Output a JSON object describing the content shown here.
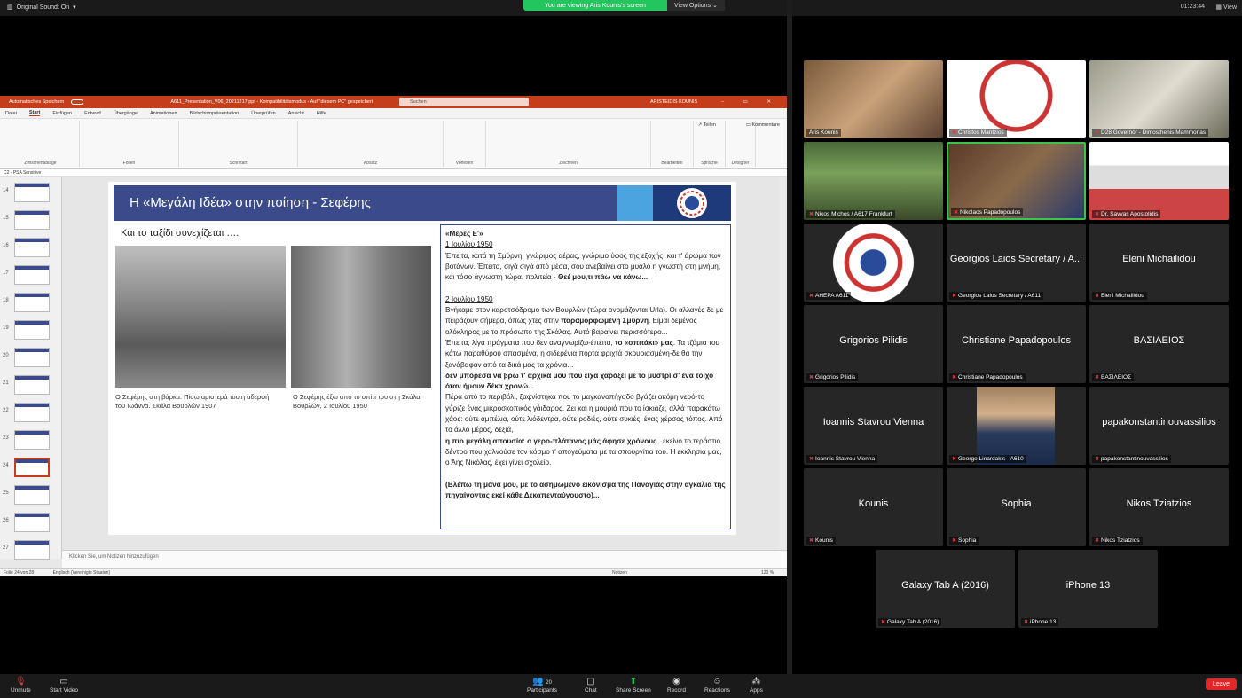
{
  "top": {
    "original_sound": "Original Sound: On",
    "viewing": "You are viewing Aris Kounis's screen",
    "view_options": "View Options",
    "clock": "01:23:44",
    "view": "View"
  },
  "ppt": {
    "autosave": "Automatisches Speichern",
    "filename": "A611_Presentation_V06_20211217.ppt - Kompatibilitätsmodus - Auf \"diesem PC\" gespeichert",
    "search": "Suchen",
    "user": "ARISTEIDIS KOUNIS",
    "tabs": [
      "Datei",
      "Start",
      "Einfügen",
      "Entwurf",
      "Übergänge",
      "Animationen",
      "Bildschirmpräsentation",
      "Überprüfen",
      "Ansicht",
      "Hilfe"
    ],
    "share": "Teilen",
    "comments": "Kommentare",
    "groups": [
      "Zwischenablage",
      "Folien",
      "Schriftart",
      "Absatz",
      "Vorlesen",
      "Zeichnen",
      "Bearbeiten",
      "Sprache",
      "Designer"
    ],
    "file_tab": "C2 - PSA Sensitive",
    "thumb_numbers": [
      "14",
      "15",
      "16",
      "17",
      "18",
      "19",
      "20",
      "21",
      "22",
      "23",
      "24",
      "25",
      "26",
      "27"
    ],
    "notes": "Klicken Sie, um Notizen hinzuzufügen",
    "status_left": "Folie 24 von 28",
    "status_lang": "Englisch (Vereinigte Staaten)",
    "status_notes": "Notizen",
    "zoom": "120 %"
  },
  "slide": {
    "title": "Η «Μεγάλη Ιδέα» στην ποίηση - Σεφέρης",
    "subtitle": "Και το ταξίδι συνεχίζεται ….",
    "caption1": "Ο Σεφέρης στη βάρκα. Πίσω αριστερά του η αδερφή του Ιωάννα. Σκάλα Βουρλών 1907",
    "caption2": "Ο Σεφέρης έξω από το σπίτι του στη Σκάλα Βουρλών, 2 Ιουλίου 1950",
    "t_head": "«Μέρες Ε'»",
    "t_date1": "1 Ιουλίου 1950",
    "t_p1": "Έπειτα, κατά τη Σμύρνη: γνώριμος αέρας, γνώριμο ύφος της εξοχής, και τ' άρωμα των βοτάνων. Έπειτα, σιγά σιγά από μέσα, σου ανεβαίνει στο μυαλό η γνωστή στη μνήμη, και τόσο άγνωστη τώρα, πολιτεία - ",
    "t_p1b": "Θεέ μου,τι πάω να κάνω...",
    "t_date2": "2 Ιουλίου 1950",
    "t_p2a": "Βγήκαμε στον καροτσόδρομο των Βουρλών (τώρα ονομάζονται Urla). Οι αλλαγές δε με πειράζουν σήμερα, όπως χτες στην ",
    "t_p2b": "παραμορφωμένη Σμύρνη",
    "t_p2c": ". Είμαι δεμένος ολόκληρος με το πρόσωπο της Σκάλας. Αυτό βαραίνει περισσότερο...",
    "t_p3a": "Έπειτα, λίγα πράγματα που δεν αναγνωρίζω-έπειτα, ",
    "t_p3b": "το «σπιτάκι» μας",
    "t_p3c": ". Τα τζάμια του κάτω παραθύρου σπασμένα, η σιδερένια πόρτα φριχτά σκουριασμένη-δε θα την ξανάβαφαν από τα δικά μας τα χρόνια...",
    "t_p4": "δεν μπόρεσα να βρω τ' αρχικά μου που είχα χαράξει με το μυστρί σ' ένα τοίχο όταν ήμουν δέκα χρονώ...",
    "t_p5": "Πέρα από το περιβόλι, ξαφνίστηκα που το μαγκανοπήγαδο βγάζει ακόμη νερό-το γύριζε ένας μικροσκοπικός γάιδαρος. Ζει και η μουριά που το ίσκιαζε, αλλά παρακάτω χάος: ούτε αμπέλια, ούτε λιόδεντρα, ούτε ροδιές, ούτε συκιές: ένας χέρσος τόπος. Από το άλλο μέρος, δεξιά,",
    "t_p6a": "η πιο μεγάλη απουσία: ο γερο-πλάτανος μάς άφησε χρόνους",
    "t_p6b": "...εκείνο το τεράστιο δέντρο που χαλνούσε τον κόσμο τ' απογεύματα με τα σπουργίτια του. Η εκκλησιά μας, ο Άης Νικόλας, έχει γίνει σχολείο.",
    "t_p7": "(Βλέπω τη μάνα μου, με το ασημωμένο εικόνισμα της Παναγιάς στην αγκαλιά της πηγαίνοντας εκεί κάθε Δεκαπενταύγουστο)..."
  },
  "participants": [
    {
      "name": "Aris Kounis",
      "type": "video"
    },
    {
      "name": "Christos Mantzios",
      "type": "video"
    },
    {
      "name": "D28 Governor - Dimosthenis Mammonas",
      "type": "video"
    },
    {
      "name": "Nikos Michos / A617 Frankfurt",
      "type": "video"
    },
    {
      "name": "Nikolaos Papadopoulos",
      "type": "video"
    },
    {
      "name": "Dr. Savvas Apostolidis",
      "type": "video"
    },
    {
      "name": "AHEPA A611",
      "type": "logo"
    },
    {
      "name": "Georgios Laios Secretary / A611",
      "center": "Georgios Laios Secretary / A...",
      "type": "name"
    },
    {
      "name": "Eleni Michailidou",
      "center": "Eleni Michailidou",
      "type": "name"
    },
    {
      "name": "Grigorios Pilidis",
      "center": "Grigorios Pilidis",
      "type": "name"
    },
    {
      "name": "Christiane Papadopoulos",
      "center": "Christiane Papadopoulos",
      "type": "name"
    },
    {
      "name": "ΒΑΣΙΛΕΙΟΣ",
      "center": "ΒΑΣΙΛΕΙΟΣ",
      "type": "name"
    },
    {
      "name": "Ioannis Stavrou Vienna",
      "center": "Ioannis Stavrou Vienna",
      "type": "name"
    },
    {
      "name": "George Linardakis - A610",
      "type": "photo"
    },
    {
      "name": "papakonstantinouvassilios",
      "center": "papakonstantinouvassilios",
      "type": "name"
    },
    {
      "name": "Kounis",
      "center": "Kounis",
      "type": "name"
    },
    {
      "name": "Sophia",
      "center": "Sophia",
      "type": "name"
    },
    {
      "name": "Nikos Tziatzios",
      "center": "Nikos Tziatzios",
      "type": "name"
    },
    {
      "name": "Galaxy Tab A (2016)",
      "center": "Galaxy Tab A (2016)",
      "type": "name"
    },
    {
      "name": "iPhone 13",
      "center": "iPhone 13",
      "type": "name"
    }
  ],
  "toolbar": {
    "unmute": "Unmute",
    "start_video": "Start Video",
    "participants": "Participants",
    "participants_count": "20",
    "chat": "Chat",
    "share": "Share Screen",
    "record": "Record",
    "reactions": "Reactions",
    "apps": "Apps",
    "leave": "Leave"
  }
}
